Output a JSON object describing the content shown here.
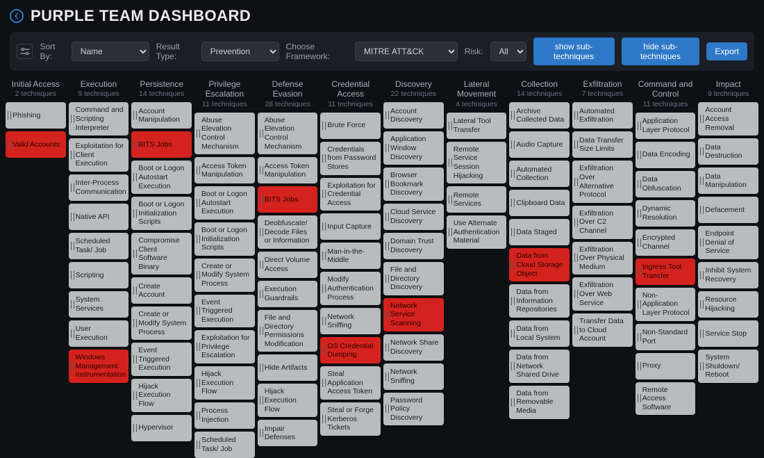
{
  "header": {
    "title": "PURPLE TEAM DASHBOARD"
  },
  "toolbar": {
    "sort_label": "Sort By:",
    "sort_value": "Name",
    "result_label": "Result Type:",
    "result_value": "Prevention",
    "framework_label": "Choose Framework:",
    "framework_value": "MITRE ATT&CK",
    "risk_label": "Risk:",
    "risk_value": "All",
    "show_sub": "show sub-techniques",
    "hide_sub": "hide sub-techniques",
    "export": "Export"
  },
  "columns": [
    {
      "title": "Initial Access",
      "sub": "2 techniques",
      "cells": [
        {
          "label": "Phishing",
          "red": false
        },
        {
          "label": "Valid Accounts",
          "red": true
        }
      ]
    },
    {
      "title": "Execution",
      "sub": "9 techniques",
      "cells": [
        {
          "label": "Command and Scripting Interpreter"
        },
        {
          "label": "Exploitation for Client Execution"
        },
        {
          "label": "Inter-Process Communication"
        },
        {
          "label": "Native API"
        },
        {
          "label": "Scheduled Task/ Job"
        },
        {
          "label": "Scripting"
        },
        {
          "label": "System Services"
        },
        {
          "label": "User Execution"
        },
        {
          "label": "Windows Management Instrumentation",
          "red": true
        }
      ]
    },
    {
      "title": "Persistence",
      "sub": "14 techniques",
      "cells": [
        {
          "label": "Account Manipulation"
        },
        {
          "label": "BITS Jobs",
          "red": true
        },
        {
          "label": "Boot or Logon Autostart Execution"
        },
        {
          "label": "Boot or Logon Initialization Scripts"
        },
        {
          "label": "Compromise Client Software Binary"
        },
        {
          "label": "Create Account"
        },
        {
          "label": "Create or Modify System Process"
        },
        {
          "label": "Event Triggered Execution"
        },
        {
          "label": "Hijack Execution Flow"
        },
        {
          "label": "Hypervisor"
        }
      ]
    },
    {
      "title": "Privilege Escalation",
      "sub": "11 techniques",
      "cells": [
        {
          "label": "Abuse Elevation Control Mechanism"
        },
        {
          "label": "Access Token Manipulation"
        },
        {
          "label": "Boot or Logon Autostart Execution"
        },
        {
          "label": "Boot or Logon Initialization Scripts"
        },
        {
          "label": "Create or Modify System Process"
        },
        {
          "label": "Event Triggered Execution"
        },
        {
          "label": "Exploitation for Privilege Escalation"
        },
        {
          "label": "Hijack Execution Flow"
        },
        {
          "label": "Process Injection"
        },
        {
          "label": "Scheduled Task/ Job"
        }
      ]
    },
    {
      "title": "Defense Evasion",
      "sub": "28 techniques",
      "cells": [
        {
          "label": "Abuse Elevation Control Mechanism"
        },
        {
          "label": "Access Token Manipulation"
        },
        {
          "label": "BITS Jobs",
          "red": true
        },
        {
          "label": "Deobfuscate/ Decode Files or Information"
        },
        {
          "label": "Direct Volume Access"
        },
        {
          "label": "Execution Guardrails"
        },
        {
          "label": "File and Directory Permissions Modification"
        },
        {
          "label": "Hide Artifacts"
        },
        {
          "label": "Hijack Execution Flow"
        },
        {
          "label": "Impair Defenses"
        }
      ]
    },
    {
      "title": "Credential Access",
      "sub": "11 techniques",
      "cells": [
        {
          "label": "Brute Force"
        },
        {
          "label": "Credentials from Password Stores"
        },
        {
          "label": "Exploitation for Credential Access"
        },
        {
          "label": "Input Capture"
        },
        {
          "label": "Man-in-the-Middle"
        },
        {
          "label": "Modify Authentication Process"
        },
        {
          "label": "Network Sniffing"
        },
        {
          "label": "OS Credential Dumping",
          "red": true
        },
        {
          "label": "Steal Application Access Token"
        },
        {
          "label": "Steal or Forge Kerberos Tickets"
        }
      ]
    },
    {
      "title": "Discovery",
      "sub": "22 techniques",
      "cells": [
        {
          "label": "Account Discovery"
        },
        {
          "label": "Application Window Discovery"
        },
        {
          "label": "Browser Bookmark Discovery"
        },
        {
          "label": "Cloud Service Discovery"
        },
        {
          "label": "Domain Trust Discovery"
        },
        {
          "label": "File and Directory Discovery"
        },
        {
          "label": "Network Service Scanning",
          "red": true
        },
        {
          "label": "Network Share Discovery"
        },
        {
          "label": "Network Sniffing"
        },
        {
          "label": "Password Policy Discovery"
        }
      ]
    },
    {
      "title": "Lateral Movement",
      "sub": "4 techniques",
      "cells": [
        {
          "label": "Lateral Tool Transfer"
        },
        {
          "label": "Remote Service Session Hijacking"
        },
        {
          "label": "Remote Services"
        },
        {
          "label": "Use Alternate Authentication Material"
        }
      ]
    },
    {
      "title": "Collection",
      "sub": "14 techniques",
      "cells": [
        {
          "label": "Archive Collected Data"
        },
        {
          "label": "Audio Capture"
        },
        {
          "label": "Automated Collection"
        },
        {
          "label": "Clipboard Data"
        },
        {
          "label": "Data Staged"
        },
        {
          "label": "Data from Cloud Storage Object",
          "red": true
        },
        {
          "label": "Data from Information Repositories"
        },
        {
          "label": "Data from Local System"
        },
        {
          "label": "Data from Network Shared Drive"
        },
        {
          "label": "Data from Removable Media"
        }
      ]
    },
    {
      "title": "Exfiltration",
      "sub": "7 techniques",
      "cells": [
        {
          "label": "Automated Exfiltration"
        },
        {
          "label": "Data Transfer Size Limits"
        },
        {
          "label": "Exfiltration Over Alternative Protocol"
        },
        {
          "label": "Exfiltration Over C2 Channel"
        },
        {
          "label": "Exfiltration Over Physical Medium"
        },
        {
          "label": "Exfiltration Over Web Service"
        },
        {
          "label": "Transfer Data to Cloud Account"
        }
      ]
    },
    {
      "title": "Command and Control",
      "sub": "11 techniques",
      "cells": [
        {
          "label": "Application Layer Protocol"
        },
        {
          "label": "Data Encoding"
        },
        {
          "label": "Data Obfuscation"
        },
        {
          "label": "Dynamic Resolution"
        },
        {
          "label": "Encrypted Channel"
        },
        {
          "label": "Ingress Tool Transfer",
          "red": true
        },
        {
          "label": "Non-Application Layer Protocol"
        },
        {
          "label": "Non-Standard Port"
        },
        {
          "label": "Proxy"
        },
        {
          "label": "Remote Access Software"
        }
      ]
    },
    {
      "title": "Impact",
      "sub": "9 techniques",
      "cells": [
        {
          "label": "Account Access Removal"
        },
        {
          "label": "Data Destruction"
        },
        {
          "label": "Data Manipulation"
        },
        {
          "label": "Defacement"
        },
        {
          "label": "Endpoint Denial of Service"
        },
        {
          "label": "Inhibit System Recovery"
        },
        {
          "label": "Resource Hijacking"
        },
        {
          "label": "Service Stop"
        },
        {
          "label": "System Shutdown/ Reboot"
        }
      ]
    }
  ]
}
